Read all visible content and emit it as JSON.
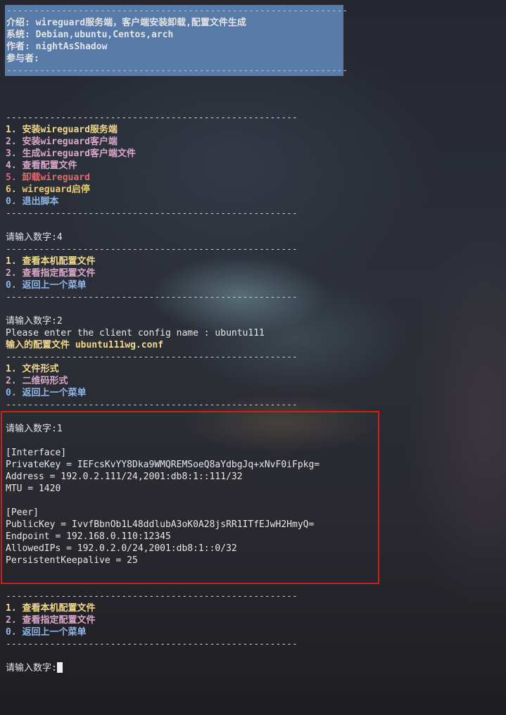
{
  "header": {
    "rule": "--------------------------------------------------------------",
    "intro": "介绍: wireguard服务端，客户端安装卸载,配置文件生成",
    "systems": "系统: Debian,ubuntu,Centos,arch",
    "author": "作者: nightAsShadow",
    "contributors": "参与者:"
  },
  "main_menu": {
    "rule": "-----------------------------------------------------",
    "items": [
      "1. 安装wireguard服务端",
      "2. 安装wireguard客户端",
      "3. 生成wireguard客户端文件",
      "4. 查看配置文件",
      "5. 卸载wireguard",
      "6. wireguard启停",
      "0. 退出脚本"
    ]
  },
  "prompt1": "请输入数字:4",
  "config_menu": {
    "items": [
      "1. 查看本机配置文件",
      "2. 查看指定配置文件",
      "0. 返回上一个菜单"
    ]
  },
  "prompt2": "请输入数字:2",
  "client_prompt": "Please enter the client config name : ubuntu111",
  "input_file": "输入的配置文件 ubuntu111wg.conf",
  "format_menu": {
    "items": [
      "1. 文件形式",
      "2. 二维码形式",
      "0. 返回上一个菜单"
    ]
  },
  "prompt3": "请输入数字:1",
  "config": {
    "interface_header": "[Interface]",
    "private_key": "PrivateKey = IEFcsKvYY8Dka9WMQREMSoeQ8aYdbgJq+xNvF0iFpkg=",
    "address": "Address = 192.0.2.111/24,2001:db8:1::111/32",
    "mtu": "MTU = 1420",
    "peer_header": "[Peer]",
    "public_key": "PublicKey = IvvfBbnOb1L48ddlubA3oK0A28jsRR1ITfEJwH2HmyQ=",
    "endpoint": "Endpoint = 192.168.0.110:12345",
    "allowed_ips": "AllowedIPs = 192.0.2.0/24,2001:db8:1::0/32",
    "keepalive": "PersistentKeepalive = 25"
  },
  "config_menu_2": {
    "items": [
      "1. 查看本机配置文件",
      "2. 查看指定配置文件",
      "0. 返回上一个菜单"
    ]
  },
  "prompt4": "请输入数字:",
  "colors": {
    "header_bg": "#5d82b3",
    "highlight_border": "#e0161b",
    "menu_yellow": "#f2d98a",
    "menu_pink": "#d9a8c8",
    "menu_red": "#e06a6a",
    "menu_blue": "#8fb6e8"
  }
}
